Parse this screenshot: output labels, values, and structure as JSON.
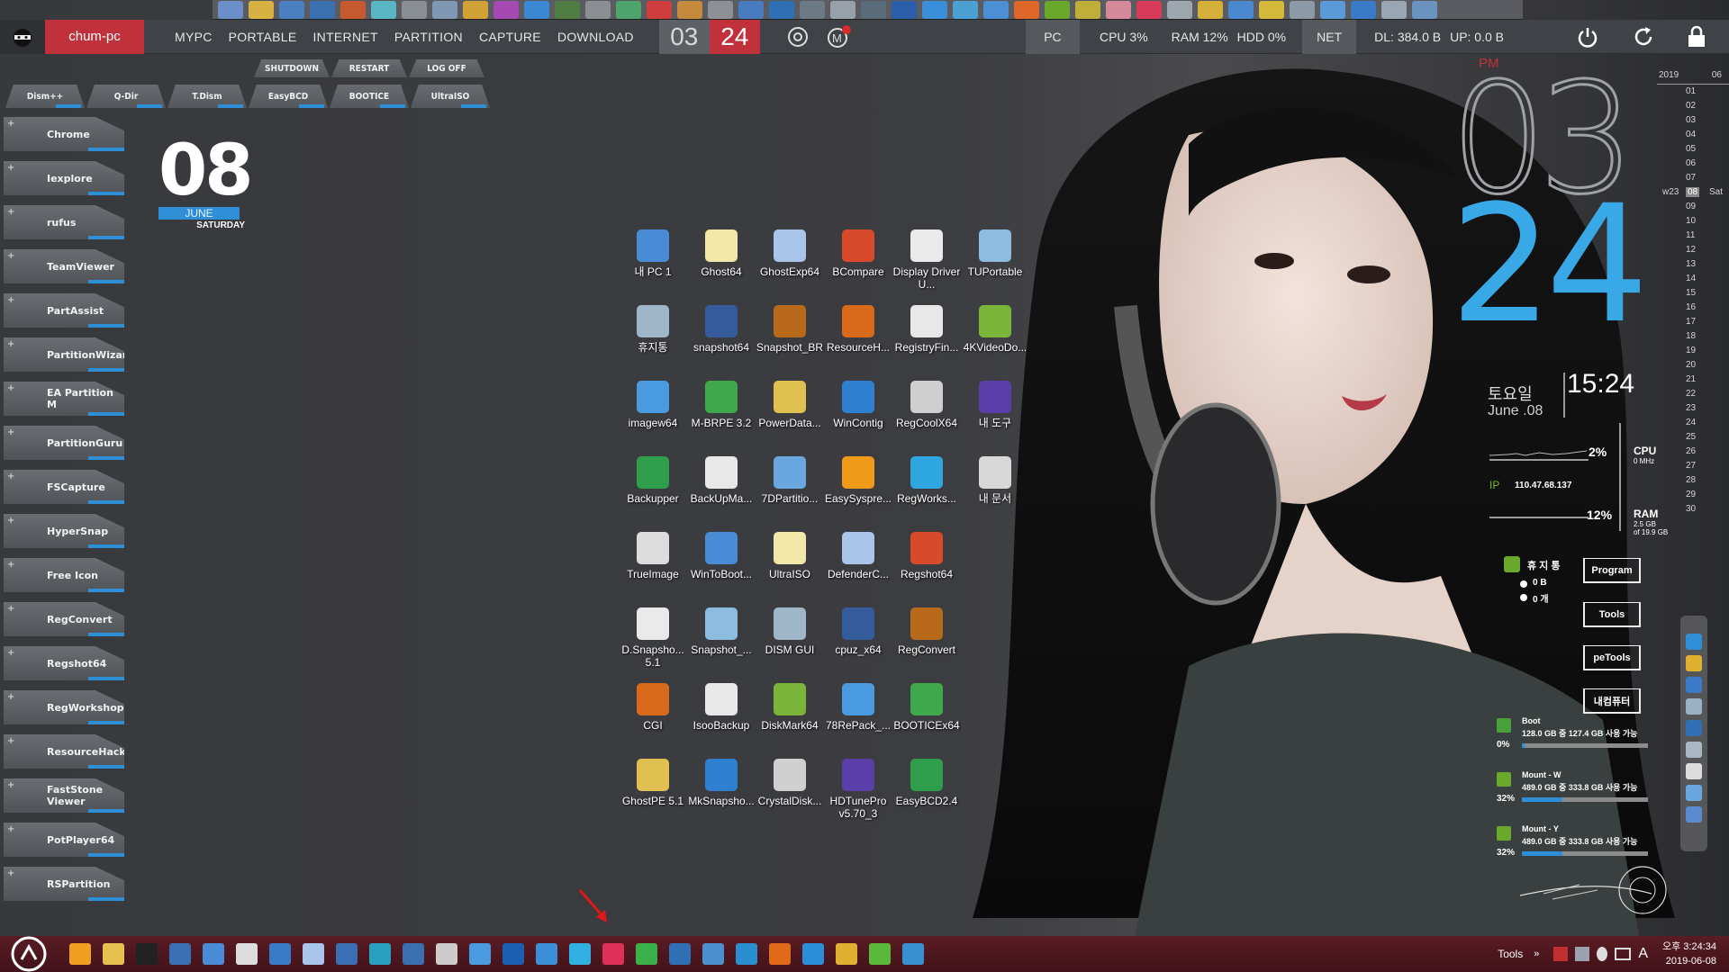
{
  "topbar": {
    "pc_name": "chum-pc",
    "menu": [
      "MYPC",
      "PORTABLE",
      "INTERNET",
      "PARTITION",
      "CAPTURE",
      "DOWNLOAD"
    ],
    "hour": "03",
    "minute": "24",
    "pc_label": "PC",
    "cpu": "CPU  3%",
    "ram": "RAM  12%",
    "hdd": "HDD  0%",
    "net_label": "NET",
    "download": "DL: 384.0 B",
    "upload": "UP: 0.0 B"
  },
  "power_tabs": [
    "SHUTDOWN",
    "RESTART",
    "LOG OFF"
  ],
  "tool_tabs": [
    "Dism++",
    "Q-Dir",
    "T.Dism",
    "EasyBCD",
    "BOOTICE",
    "UltraISO"
  ],
  "launcher": [
    "Chrome",
    "Iexplore",
    "rufus",
    "TeamViewer",
    "PartAssist",
    "PartitionWizard",
    "EA Partition M",
    "PartitionGuru",
    "FSCapture",
    "HyperSnap",
    "Free Icon",
    "RegConvert",
    "Regshot64",
    "RegWorkshop",
    "ResourceHacker",
    "FastStone Viewer",
    "PotPlayer64",
    "RSPartition"
  ],
  "date_widget": {
    "day": "08",
    "month": "JUNE",
    "weekday": "SATURDAY"
  },
  "desktop_icons": [
    [
      "내 PC 1",
      "Ghost64",
      "GhostExp64",
      "BCompare",
      "Display Driver U...",
      "TUPortable"
    ],
    [
      "휴지통",
      "snapshot64",
      "Snapshot_BR",
      "ResourceH...",
      "RegistryFin...",
      "4KVideoDo..."
    ],
    [
      "imagew64",
      "M-BRPE 3.2",
      "PowerData...",
      "WinContig",
      "RegCoolX64",
      "내 도구"
    ],
    [
      "Backupper",
      "BackUpMa...",
      "7DPartitio...",
      "EasySyspre...",
      "RegWorks...",
      "내 문서"
    ],
    [
      "TrueImage",
      "WinToBoot...",
      "UltraISO",
      "DefenderC...",
      "Regshot64",
      ""
    ],
    [
      "D.Snapsho... 5.1",
      "Snapshot_...",
      "DISM GUI",
      "cpuz_x64",
      "RegConvert",
      ""
    ],
    [
      "CGI",
      "IsooBackup",
      "DiskMark64",
      "78RePack_...",
      "BOOTICEx64",
      ""
    ],
    [
      "GhostPE 5.1",
      "MkSnapsho...",
      "CrystalDisk...",
      "HDTunePro v5.70_3",
      "EasyBCD2.4",
      ""
    ]
  ],
  "big_clock": {
    "ampm": "PM",
    "hour": "03",
    "minute": "24"
  },
  "calendar": {
    "year": "2019",
    "month": "06",
    "week": "w23",
    "today": "08",
    "today_wday": "Sat",
    "days": [
      "01",
      "02",
      "03",
      "04",
      "05",
      "06",
      "07",
      "08",
      "09",
      "10",
      "11",
      "12",
      "13",
      "14",
      "15",
      "16",
      "17",
      "18",
      "19",
      "20",
      "21",
      "22",
      "23",
      "24",
      "25",
      "26",
      "27",
      "28",
      "29",
      "30"
    ]
  },
  "info_widget": {
    "weekday_kr": "토요일",
    "date": "June .08",
    "time": "15:24",
    "cpu_pct": "2%",
    "cpu_label": "CPU",
    "cpu_mhz": "0 MHz",
    "ip_label": "IP",
    "ip": "110.47.68.137",
    "ram_pct": "12%",
    "ram_label": "RAM",
    "ram_used": "2.5 GB",
    "ram_total": "of 19.9 GB",
    "recycle_label": "휴 지 통",
    "recycle_size": "0 B",
    "recycle_count": "0 개"
  },
  "side_buttons": [
    "Program",
    "Tools",
    "peTools",
    "내컴퓨터"
  ],
  "drives": [
    {
      "name": "Boot",
      "info": "128.0 GB 중 127.4 GB 사용 가능",
      "pct": "0%",
      "fill": 0.01
    },
    {
      "name": "Mount - W",
      "info": "489.0 GB 중 333.8 GB 사용 가능",
      "pct": "32%",
      "fill": 0.32
    },
    {
      "name": "Mount - Y",
      "info": "489.0 GB 중 333.8 GB 사용 가능",
      "pct": "32%",
      "fill": 0.32
    }
  ],
  "taskbar": {
    "tools_label": "Tools",
    "tray_time": "오후 3:24:34",
    "tray_date": "2019-06-08",
    "ime": "A"
  },
  "colors": {
    "accent_red": "#c0313b",
    "accent_blue": "#2f8fd6",
    "clock_blue": "#38a8e6"
  }
}
